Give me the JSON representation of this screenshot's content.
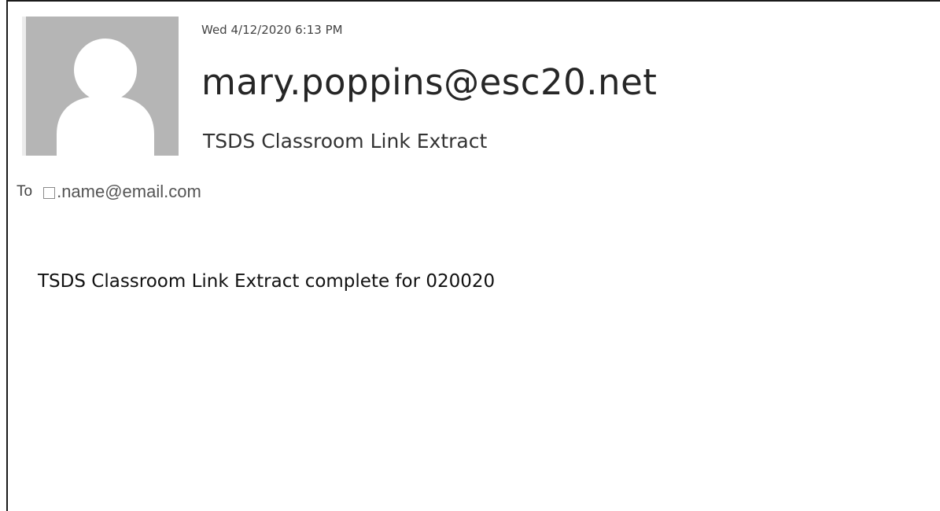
{
  "message": {
    "date": "Wed 4/12/2020 6:13 PM",
    "sender": "mary.poppins@esc20.net",
    "subject": "TSDS Classroom Link Extract",
    "to_label": "To",
    "to_recipient": ".name@email.com",
    "body": "TSDS Classroom Link Extract complete for 020020"
  },
  "icons": {
    "avatar": "person-placeholder-icon",
    "recipient_checkbox": "checkbox-icon"
  },
  "colors": {
    "avatar_bg": "#b5b5b5",
    "avatar_silhouette": "#ffffff",
    "text_dark": "#262626"
  }
}
